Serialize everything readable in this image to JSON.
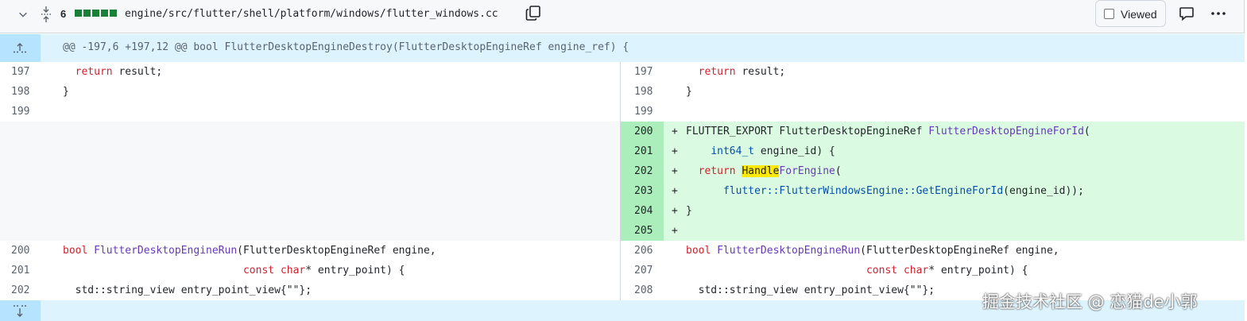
{
  "file_header": {
    "changes_count": "6",
    "file_path": "engine/src/flutter/shell/platform/windows/flutter_windows.cc",
    "viewed_label": "Viewed",
    "diffstat_color": "#1a7f37"
  },
  "hunk_top": {
    "text": "@@ -197,6 +197,12 @@ bool FlutterDesktopEngineDestroy(FlutterDesktopEngineRef engine_ref) {"
  },
  "left": {
    "nums": [
      "197",
      "198",
      "199",
      "200",
      "201",
      "202"
    ]
  },
  "right": {
    "nums": [
      "197",
      "198",
      "199",
      "200",
      "201",
      "202",
      "203",
      "204",
      "205",
      "206",
      "207",
      "208"
    ]
  },
  "code": {
    "return_kw": "return",
    "result_line": " result;",
    "brace_close": "}",
    "flutter_export": "FLUTTER_EXPORT FlutterDesktopEngineRef ",
    "get_for_id_fn": "FlutterDesktopEngineForId",
    "paren_open": "(",
    "int64_t": "int64_t",
    "engine_id_param": " engine_id) {",
    "handle": "Handle",
    "for_engine": "ForEngine",
    "ns_call": "flutter::FlutterWindowsEngine::GetEngineForId",
    "ns_args": "(engine_id));",
    "bool_kw": "bool",
    "run_fn": "FlutterDesktopEngineRun",
    "run_args": "(FlutterDesktopEngineRef engine,",
    "const_kw": "const",
    "char_kw": "char",
    "entry_point": "* entry_point) {",
    "string_view_line": "std::string_view entry_point_view{\"\"};",
    "plus": "+"
  },
  "watermark": "掘金技术社区 @ 恋猫de小郭",
  "colors": {
    "added_bg": "#dafbe1",
    "added_num_bg": "#aceebb",
    "hunk_bg": "#ddf4ff",
    "keyword": "#cf222e",
    "function": "#6639ba",
    "type": "#0550ae",
    "highlight": "#ffea00"
  }
}
